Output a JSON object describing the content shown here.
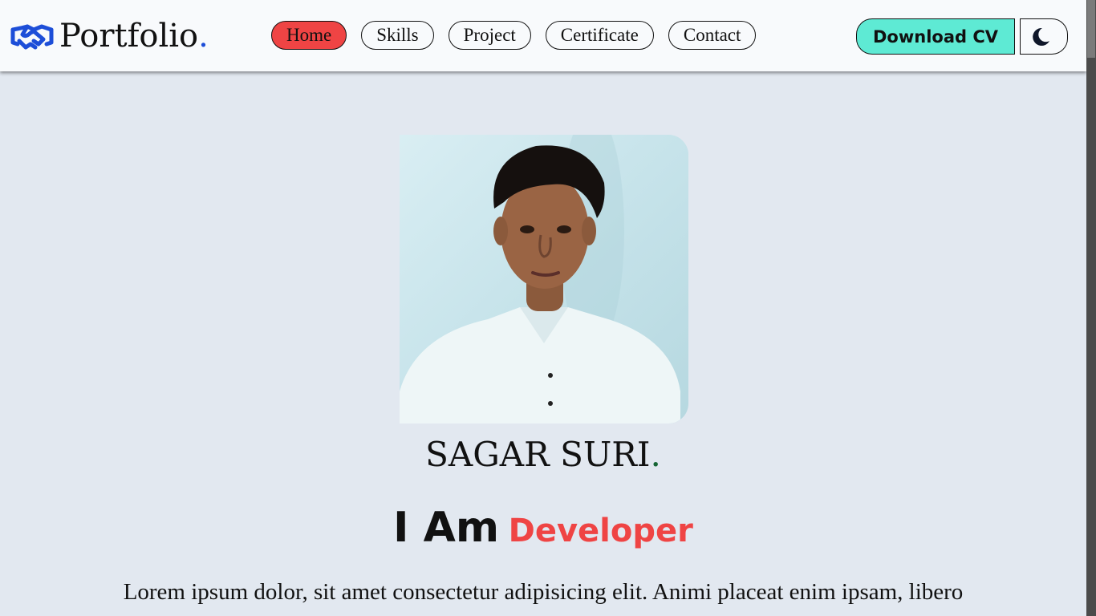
{
  "brand": {
    "name": "Portfolio",
    "dot": ".",
    "icon": "handshake-icon",
    "color": "#1d4ed8"
  },
  "nav": {
    "items": [
      {
        "label": "Home",
        "active": true
      },
      {
        "label": "Skills"
      },
      {
        "label": "Project"
      },
      {
        "label": "Certificate"
      },
      {
        "label": "Contact"
      }
    ],
    "download_label": "Download CV",
    "theme_icon": "moon-icon"
  },
  "hero": {
    "photo": "profile-photo",
    "name": "SAGAR SURI",
    "name_dot": ".",
    "tagline_prefix": "I Am",
    "tagline_role": "Developer",
    "description": "Lorem ipsum dolor, sit amet consectetur adipisicing elit. Animi placeat enim ipsam, libero"
  },
  "colors": {
    "background": "#e2e8f0",
    "navbar": "#f8fafc",
    "active_nav": "#ef4444",
    "download_button": "#5eead4",
    "role_text": "#ef4444",
    "name_dot": "#166534"
  }
}
